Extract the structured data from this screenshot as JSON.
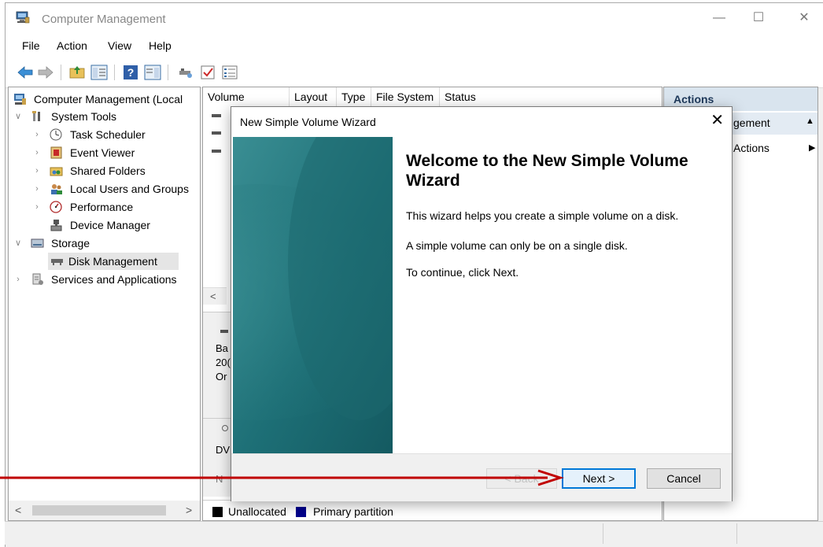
{
  "window": {
    "title": "Computer Management"
  },
  "menubar": [
    "File",
    "Action",
    "View",
    "Help"
  ],
  "tree": {
    "root": "Computer Management (Local",
    "system_tools": "System Tools",
    "task_scheduler": "Task Scheduler",
    "event_viewer": "Event Viewer",
    "shared_folders": "Shared Folders",
    "local_users": "Local Users and Groups",
    "performance": "Performance",
    "device_manager": "Device Manager",
    "storage": "Storage",
    "disk_management": "Disk Management",
    "services": "Services and Applications"
  },
  "volume_list": {
    "columns": [
      "Volume",
      "Layout",
      "Type",
      "File System",
      "Status"
    ],
    "left_scroll_glyph": "<"
  },
  "disk_fragments": [
    "Ba",
    "20(",
    "Or",
    "DV",
    "N"
  ],
  "legend": {
    "unallocated": "Unallocated",
    "primary": "Primary partition"
  },
  "actions_pane": {
    "header": "Actions",
    "item1": "gement",
    "item2": "Actions"
  },
  "tree_scroll": {
    "left": "<",
    "right": ">"
  },
  "wizard": {
    "title": "New Simple Volume Wizard",
    "close": "✕",
    "heading": "Welcome to the New Simple Volume Wizard",
    "line1": "This wizard helps you create a simple volume on a disk.",
    "line2": "A simple volume can only be on a single disk.",
    "line3": "To continue, click Next.",
    "back": "< Back",
    "next": "Next >",
    "cancel": "Cancel"
  },
  "colors": {
    "annotation_arrow": "#c00000",
    "banner_teal": "#1d6f76",
    "actions_header_bg": "#d9e4ee",
    "focus_border": "#0078d7"
  }
}
